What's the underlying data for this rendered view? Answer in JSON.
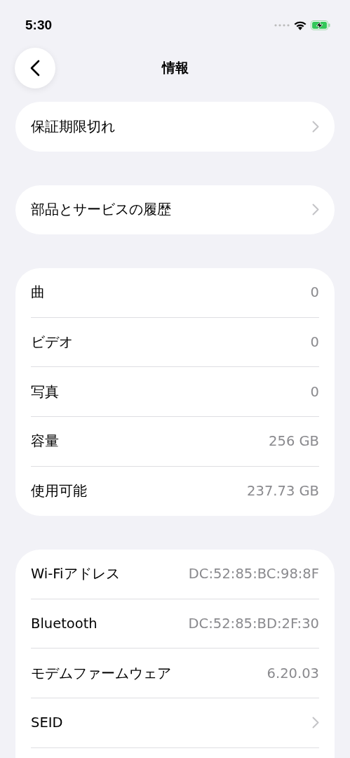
{
  "status_bar": {
    "time": "5:30"
  },
  "header": {
    "title": "情報"
  },
  "groups": [
    {
      "continues": false,
      "rows": [
        {
          "label": "保証期限切れ",
          "kind": "link"
        }
      ]
    },
    {
      "continues": false,
      "rows": [
        {
          "label": "部品とサービスの履歴",
          "kind": "link"
        }
      ]
    },
    {
      "continues": false,
      "rows": [
        {
          "label": "曲",
          "kind": "value",
          "value": "0"
        },
        {
          "label": "ビデオ",
          "kind": "value",
          "value": "0"
        },
        {
          "label": "写真",
          "kind": "value",
          "value": "0"
        },
        {
          "label": "容量",
          "kind": "value",
          "value": "256 GB"
        },
        {
          "label": "使用可能",
          "kind": "value",
          "value": "237.73 GB"
        }
      ]
    },
    {
      "continues": true,
      "rows": [
        {
          "label": "Wi-Fiアドレス",
          "kind": "value",
          "value": "DC:52:85:BC:98:8F"
        },
        {
          "label": "Bluetooth",
          "kind": "value",
          "value": "DC:52:85:BD:2F:30"
        },
        {
          "label": "モデムファームウェア",
          "kind": "value",
          "value": "6.20.03"
        },
        {
          "label": "SEID",
          "kind": "link"
        }
      ]
    }
  ]
}
